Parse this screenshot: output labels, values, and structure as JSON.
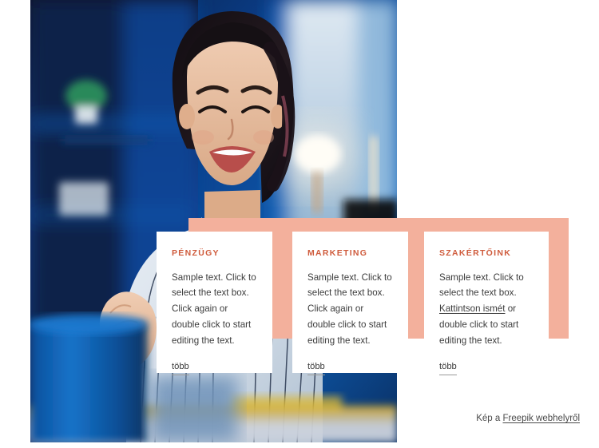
{
  "page": {
    "background_color": "#ffffff",
    "accent_color": "#cf5b3c",
    "panel_color": "#f3b09c",
    "text_color": "#3c3c3c"
  },
  "hero_image": {
    "alt": "Smiling young woman in a striped shirt working at a desk lit with blue light",
    "source_note": "Freepik"
  },
  "cards": [
    {
      "title": "PÉNZÜGY",
      "body_before_link": "Sample text. Click to select the text box. Click again or double click to start editing the text.",
      "link_text": "",
      "body_after_link": "",
      "more_label": "több"
    },
    {
      "title": "MARKETING",
      "body_before_link": "Sample text. Click to select the text box. Click again or double click to start editing the text.",
      "link_text": "",
      "body_after_link": "",
      "more_label": "több"
    },
    {
      "title": "SZAKÉRTŐINK",
      "body_before_link": "Sample text. Click to select the text box. ",
      "link_text": "Kattintson ismét",
      "body_after_link": " or double click to start editing the text.",
      "more_label": "több"
    }
  ],
  "credit": {
    "prefix": "Kép a ",
    "link_text": "Freepik webhelyről"
  }
}
